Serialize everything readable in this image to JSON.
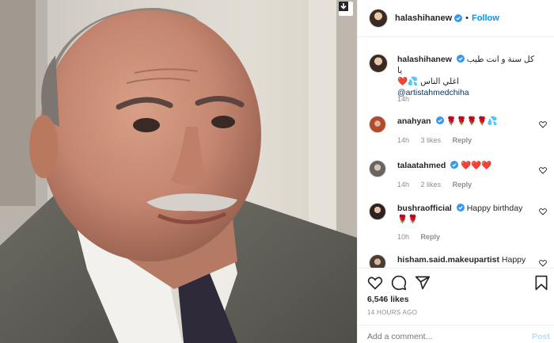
{
  "header": {
    "username": "halashihanew",
    "follow_label": "Follow"
  },
  "caption": {
    "username": "halashihanew",
    "text_line1": "كل سنة و انت طيب يا",
    "text_line2": "اغلي الناس",
    "emoji": "❤️💦",
    "mention": "@artistahmedchiha",
    "time": "14h"
  },
  "comments": [
    {
      "username": "anahyan",
      "text": "🌹🌹🌹🌹💦",
      "time": "14h",
      "likes": "3 likes",
      "reply": "Reply"
    },
    {
      "username": "talaatahmed",
      "text": "❤️❤️❤️",
      "time": "14h",
      "likes": "2 likes",
      "reply": "Reply"
    },
    {
      "username": "bushraofficial",
      "text": "Happy birthday",
      "text2": "🌹🌹",
      "time": "10h",
      "reply": "Reply"
    },
    {
      "username": "hisham.said.makeupartist",
      "text": "Happy"
    }
  ],
  "footer": {
    "likes": "6,546 likes",
    "posted": "14 HOURS AGO",
    "comment_placeholder": "Add a comment...",
    "post_label": "Post"
  },
  "colors": {
    "accent": "#0095f6",
    "heart": "#ed4956"
  }
}
